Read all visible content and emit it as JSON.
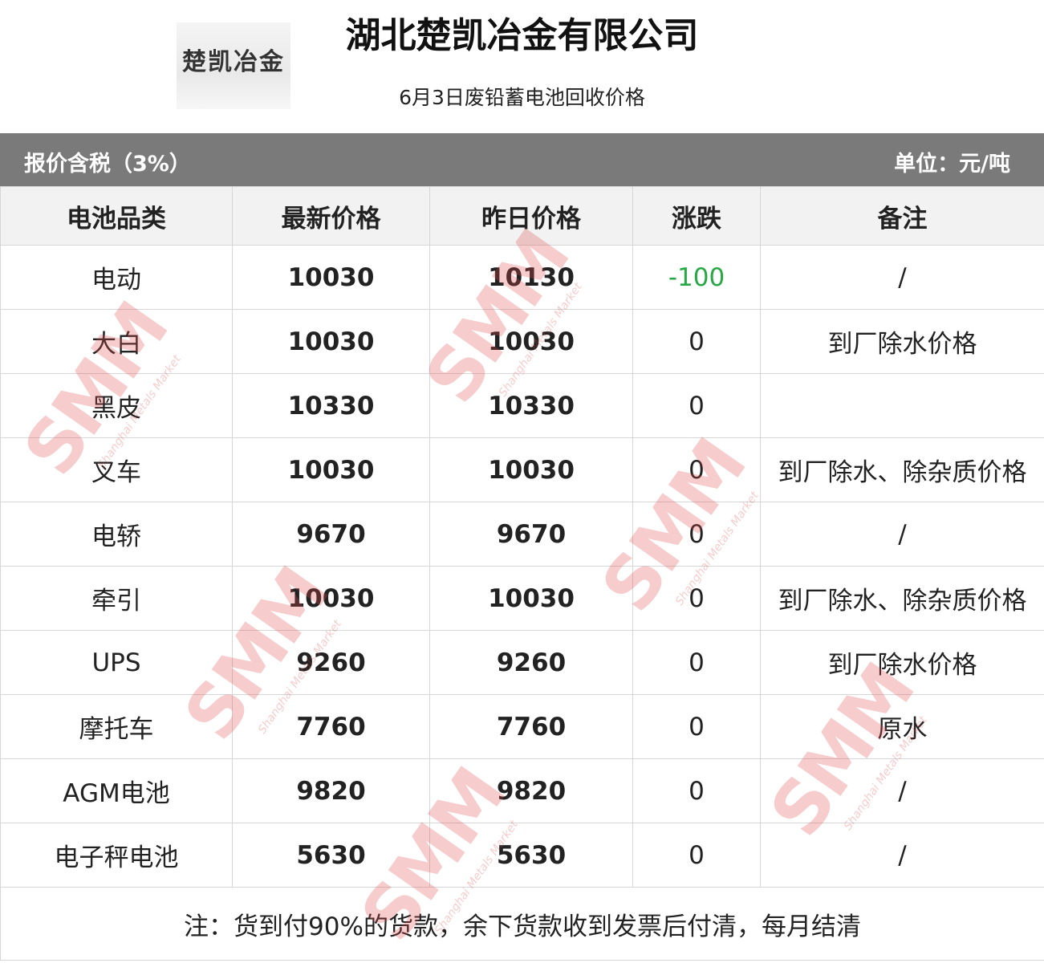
{
  "header": {
    "logo_text": "楚凯冶金",
    "company": "湖北楚凯冶金有限公司",
    "subtitle": "6月3日废铅蓄电池回收价格"
  },
  "bar": {
    "left": "报价含税（3%）",
    "right": "单位：元/吨"
  },
  "table": {
    "headers": [
      "电池品类",
      "最新价格",
      "昨日价格",
      "涨跌",
      "备注"
    ],
    "rows": [
      {
        "type": "电动",
        "latest": "10030",
        "yesterday": "10130",
        "change": "-100",
        "note": "/"
      },
      {
        "type": "大白",
        "latest": "10030",
        "yesterday": "10030",
        "change": "0",
        "note": "到厂除水价格"
      },
      {
        "type": "黑皮",
        "latest": "10330",
        "yesterday": "10330",
        "change": "0",
        "note": ""
      },
      {
        "type": "叉车",
        "latest": "10030",
        "yesterday": "10030",
        "change": "0",
        "note": "到厂除水、除杂质价格"
      },
      {
        "type": "电轿",
        "latest": "9670",
        "yesterday": "9670",
        "change": "0",
        "note": "/"
      },
      {
        "type": "牵引",
        "latest": "10030",
        "yesterday": "10030",
        "change": "0",
        "note": "到厂除水、除杂质价格"
      },
      {
        "type": "UPS",
        "latest": "9260",
        "yesterday": "9260",
        "change": "0",
        "note": "到厂除水价格"
      },
      {
        "type": "摩托车",
        "latest": "7760",
        "yesterday": "7760",
        "change": "0",
        "note": "原水"
      },
      {
        "type": "AGM电池",
        "latest": "9820",
        "yesterday": "9820",
        "change": "0",
        "note": "/"
      },
      {
        "type": "电子秤电池",
        "latest": "5630",
        "yesterday": "5630",
        "change": "0",
        "note": "/"
      }
    ],
    "footnote": "注：货到付90%的货款，余下货款收到发票后付清，每月结清"
  },
  "watermark": {
    "brand": "SMM",
    "caption": "Shanghai Metals Market"
  },
  "colors": {
    "bar_bg": "#7a7a7a",
    "header_bg": "#f2f2f2",
    "down": "#27a844",
    "watermark": "#e04b4b"
  }
}
